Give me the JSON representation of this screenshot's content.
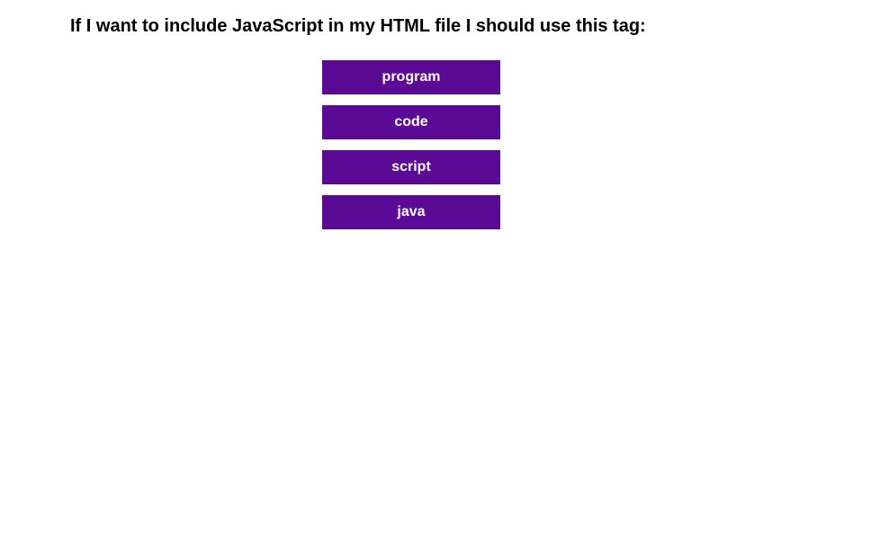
{
  "question": {
    "text": "If I want to include JavaScript in my HTML file I should use this tag:"
  },
  "options": [
    {
      "label": "program"
    },
    {
      "label": "code"
    },
    {
      "label": "script"
    },
    {
      "label": "java"
    }
  ],
  "colors": {
    "button_bg": "#5a0a94",
    "button_text": "#ffffff"
  }
}
